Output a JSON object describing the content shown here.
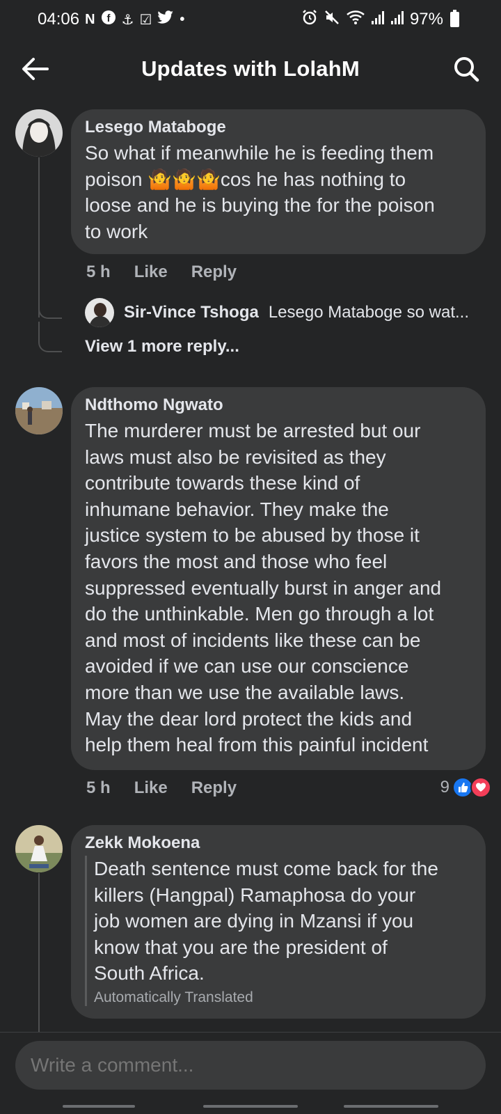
{
  "status_bar": {
    "time": "04:06",
    "app_icons": [
      "N",
      "f",
      "⚓",
      "☑",
      "✦",
      "•"
    ],
    "battery": "97%"
  },
  "header": {
    "title": "Updates with LolahM",
    "back_icon": "back-arrow-icon",
    "search_icon": "search-icon"
  },
  "comments": [
    {
      "author": "Lesego Mataboge",
      "text": "So what if meanwhile he is feeding them\npoison 🤷🤷🤷cos he has nothing to\nloose and he is buying the for the poison\nto work",
      "time": "5 h",
      "like": "Like",
      "reply": "Reply",
      "replies": {
        "author": "Sir-Vince Tshoga",
        "text": "Lesego Mataboge so wat...",
        "view_more": "View 1 more reply..."
      }
    },
    {
      "author": "Ndthomo Ngwato",
      "text": "The murderer must be arrested but our\nlaws must also be revisited as they\ncontribute towards these kind of\ninhumane behavior. They make the\njustice system to be abused by those it\nfavors the most and those who feel\nsuppressed eventually burst in anger and\ndo the unthinkable. Men go through a lot\nand most of incidents like these can be\navoided if we can use our conscience\nmore than we use the available laws.\nMay the dear lord protect the kids and\nhelp them heal from this painful incident",
      "time": "5 h",
      "like": "Like",
      "reply": "Reply",
      "reaction_count": "9"
    },
    {
      "author": "Zekk Mokoena",
      "text": "Death sentence must come back for the\nkillers (Hangpal) Ramaphosa do your\njob women are dying in Mzansi if you\nknow that you are the president of\nSouth Africa.",
      "translated_label": "Automatically Translated"
    }
  ],
  "composer": {
    "placeholder": "Write a comment..."
  },
  "colors": {
    "background": "#242526",
    "bubble": "#3a3b3c",
    "like_blue": "#1877f2",
    "love_red": "#f33e58"
  }
}
